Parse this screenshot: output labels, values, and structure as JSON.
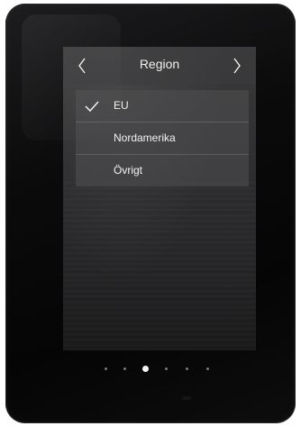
{
  "header": {
    "title": "Region",
    "prev_icon": "chevron-left-icon",
    "next_icon": "chevron-right-icon"
  },
  "region_list": {
    "selected_index": 0,
    "items": [
      {
        "label": "EU",
        "selected": true
      },
      {
        "label": "Nordamerika",
        "selected": false
      },
      {
        "label": "Övrigt",
        "selected": false
      }
    ]
  },
  "pagination": {
    "total_pages": 6,
    "current_page": 3
  },
  "colors": {
    "text": "#f2f2f2",
    "item_background": "#505052",
    "active_dot": "#f5f5f5",
    "inactive_dot": "#777777"
  }
}
